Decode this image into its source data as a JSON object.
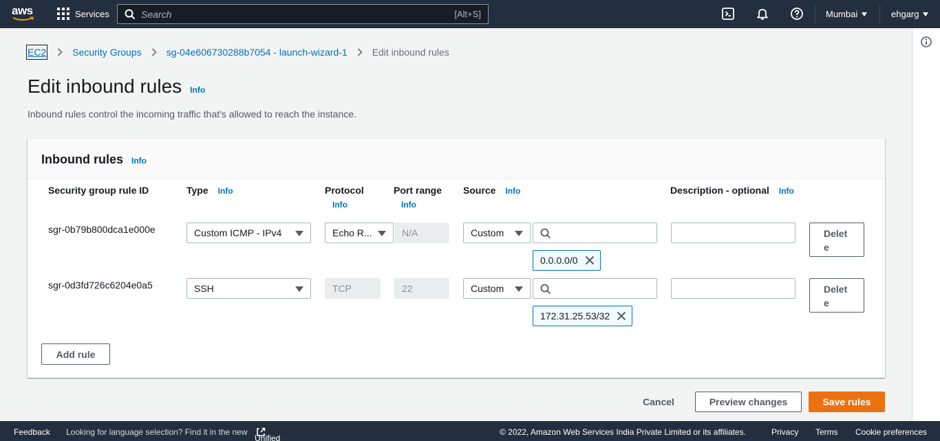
{
  "topnav": {
    "logo_text": "aws",
    "services_label": "Services",
    "search_placeholder": "Search",
    "search_shortcut": "[Alt+S]",
    "region": "Mumbai",
    "user": "ehgarg",
    "icons": [
      "cloudshell-icon",
      "bell-icon",
      "help-icon"
    ]
  },
  "breadcrumb": {
    "items": [
      "EC2",
      "Security Groups",
      "sg-04e606730288b7054 - launch-wizard-1"
    ],
    "current": "Edit inbound rules"
  },
  "page": {
    "title": "Edit inbound rules",
    "title_info": "Info",
    "description": "Inbound rules control the incoming traffic that's allowed to reach the instance."
  },
  "panel": {
    "title": "Inbound rules",
    "title_info": "Info",
    "columns": {
      "rule_id": "Security group rule ID",
      "type": "Type",
      "type_info": "Info",
      "protocol": "Protocol",
      "protocol_info": "Info",
      "port_range": "Port range",
      "port_range_info": "Info",
      "source": "Source",
      "source_info": "Info",
      "description": "Description - optional",
      "description_info": "Info"
    },
    "rows": [
      {
        "rule_id": "sgr-0b79b800dca1e000e",
        "type": "Custom ICMP - IPv4",
        "protocol": "Echo R...",
        "port_range": "N/A",
        "source_type": "Custom",
        "source_token": "0.0.0.0/0",
        "description": "",
        "delete_label_1": "Delet",
        "delete_label_2": "e"
      },
      {
        "rule_id": "sgr-0d3fd726c6204e0a5",
        "type": "SSH",
        "protocol": "TCP",
        "port_range": "22",
        "source_type": "Custom",
        "source_token": "172.31.25.53/32",
        "description": "",
        "delete_label_1": "Delet",
        "delete_label_2": "e"
      }
    ],
    "add_rule_label": "Add rule"
  },
  "actions": {
    "cancel": "Cancel",
    "preview": "Preview changes",
    "save": "Save rules"
  },
  "footer": {
    "feedback": "Feedback",
    "language_note": "Looking for language selection? Find it in the new",
    "unified_settings": "Unified Settings",
    "copyright": "© 2022, Amazon Web Services India Private Limited or its affiliates.",
    "privacy": "Privacy",
    "terms": "Terms",
    "cookie": "Cookie preferences"
  },
  "colors": {
    "nav_bg": "#232f3e",
    "link": "#0073bb",
    "primary_button": "#ec7211"
  }
}
